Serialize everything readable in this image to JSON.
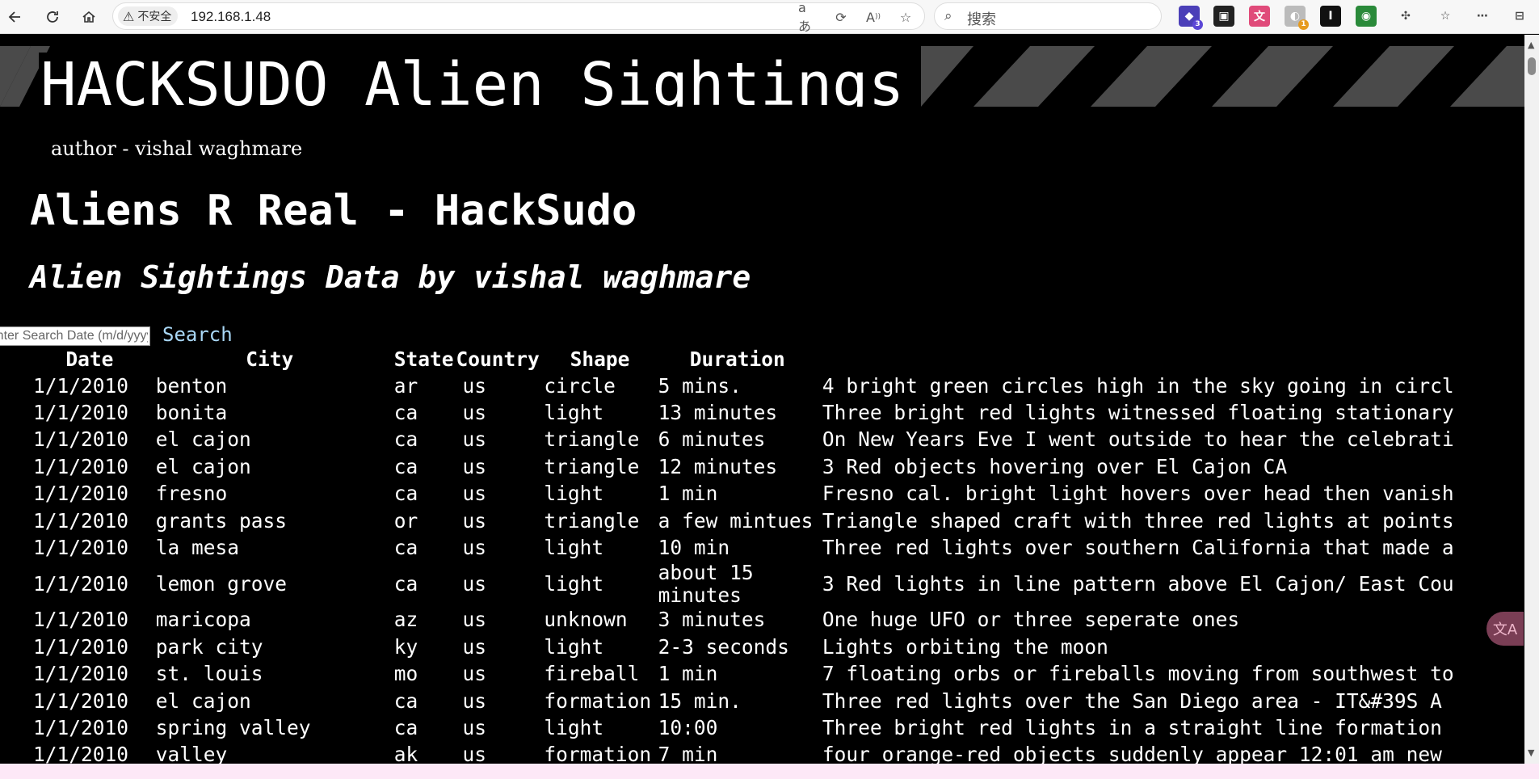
{
  "browser": {
    "security_label": "不安全",
    "url": "192.168.1.48",
    "search_placeholder": "搜索",
    "extension_badges": {
      "first": "3",
      "fourth": "1"
    }
  },
  "page": {
    "banner_title": "HACKSUDO Alien Sightings",
    "author": "author - vishal waghmare",
    "heading": "Aliens R Real - HackSudo",
    "subheading": "Alien Sightings Data by vishal waghmare",
    "date_input_placeholder": "Enter Search Date (m/d/yyyy)",
    "search_label": "Search"
  },
  "table": {
    "headers": [
      "Date",
      "City",
      "State",
      "Country",
      "Shape",
      "Duration",
      ""
    ],
    "rows": [
      [
        "1/1/2010",
        "benton",
        "ar",
        "us",
        "circle",
        "5 mins.",
        "4 bright green circles high in the sky going in circl"
      ],
      [
        "1/1/2010",
        "bonita",
        "ca",
        "us",
        "light",
        "13 minutes",
        "Three bright red lights witnessed floating stationary"
      ],
      [
        "1/1/2010",
        "el cajon",
        "ca",
        "us",
        "triangle",
        "6 minutes",
        "On New Years Eve I went outside to hear the celebrati"
      ],
      [
        "1/1/2010",
        "el cajon",
        "ca",
        "us",
        "triangle",
        "12 minutes",
        "3 Red objects hovering over El Cajon CA"
      ],
      [
        "1/1/2010",
        "fresno",
        "ca",
        "us",
        "light",
        "1 min",
        "Fresno cal. bright light hovers over head then vanish"
      ],
      [
        "1/1/2010",
        "grants pass",
        "or",
        "us",
        "triangle",
        "a few mintues",
        "Triangle shaped craft with three red lights at points"
      ],
      [
        "1/1/2010",
        "la mesa",
        "ca",
        "us",
        "light",
        "10 min",
        "Three red lights over southern California that made a"
      ],
      [
        "1/1/2010",
        "lemon grove",
        "ca",
        "us",
        "light",
        "about 15 minutes",
        "3 Red lights in line pattern above El Cajon/ East Cou"
      ],
      [
        "1/1/2010",
        "maricopa",
        "az",
        "us",
        "unknown",
        "3 minutes",
        "One huge UFO or three seperate ones"
      ],
      [
        "1/1/2010",
        "park city",
        "ky",
        "us",
        "light",
        "2-3 seconds",
        "Lights orbiting the moon"
      ],
      [
        "1/1/2010",
        "st. louis",
        "mo",
        "us",
        "fireball",
        "1 min",
        "7 floating orbs or fireballs moving from southwest to"
      ],
      [
        "1/1/2010",
        "el cajon",
        "ca",
        "us",
        "formation",
        "15 min.",
        "Three red lights over the San Diego area - IT&#39S A"
      ],
      [
        "1/1/2010",
        "spring valley",
        "ca",
        "us",
        "light",
        "10:00",
        "Three bright red lights in a straight line formation"
      ],
      [
        "1/1/2010",
        "valley",
        "ak",
        "us",
        "formation",
        "7 min",
        "four orange-red objects suddenly appear 12:01 am new"
      ]
    ]
  },
  "colors": {
    "page_background": "#000000",
    "text": "#ffffff",
    "search_link": "#a9d7f5",
    "banner_stripes": "#4a4a4a"
  }
}
